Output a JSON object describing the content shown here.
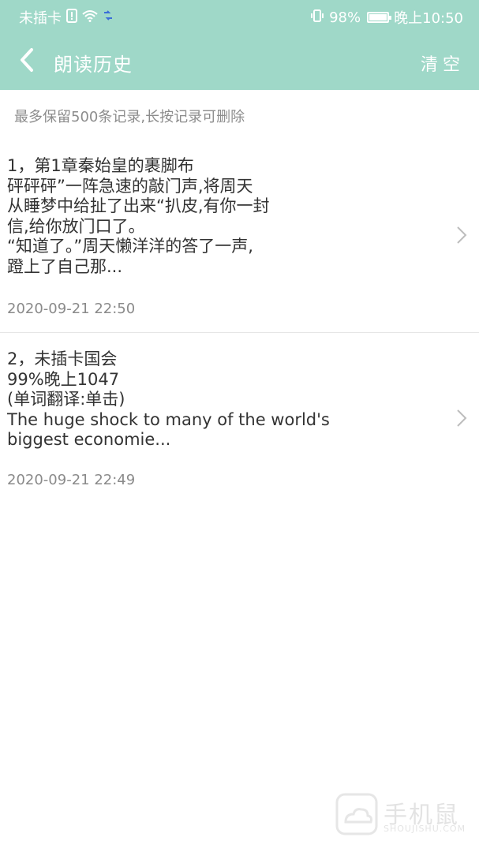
{
  "status_bar": {
    "carrier": "未插卡",
    "battery_percent": "98%",
    "time": "晚上10:50",
    "battery_level": 0.98,
    "icons": [
      "sim-alert-icon",
      "wifi-icon",
      "data-transfer-icon",
      "vibrate-icon",
      "battery-icon"
    ]
  },
  "header": {
    "title": "朗读历史",
    "clear_label": "清空",
    "back_icon": "chevron-left-icon"
  },
  "notice": "最多保留500条记录,长按记录可删除",
  "records": [
    {
      "text": "1，第1章秦始皇的裹脚布\n砰砰砰”一阵急速的敲门声,将周天\n从睡梦中给扯了出来“扒皮,有你一封\n信,给你放门口了。\n“知道了。”周天懒洋洋的答了一声,\n蹬上了自己那...",
      "time": "2020-09-21 22:50"
    },
    {
      "text": "2，未插卡国会\n99%晚上1047\n(单词翻译:单击)\nThe huge shock to many of the world's\nbiggest economie...",
      "time": "2020-09-21 22:49"
    }
  ],
  "watermark": {
    "name": "手机鼠",
    "sub": "SHOUJISHU.COM"
  },
  "colors": {
    "header_bg": "#9fd8c8",
    "text": "#333333",
    "muted": "#8a8a8a"
  }
}
